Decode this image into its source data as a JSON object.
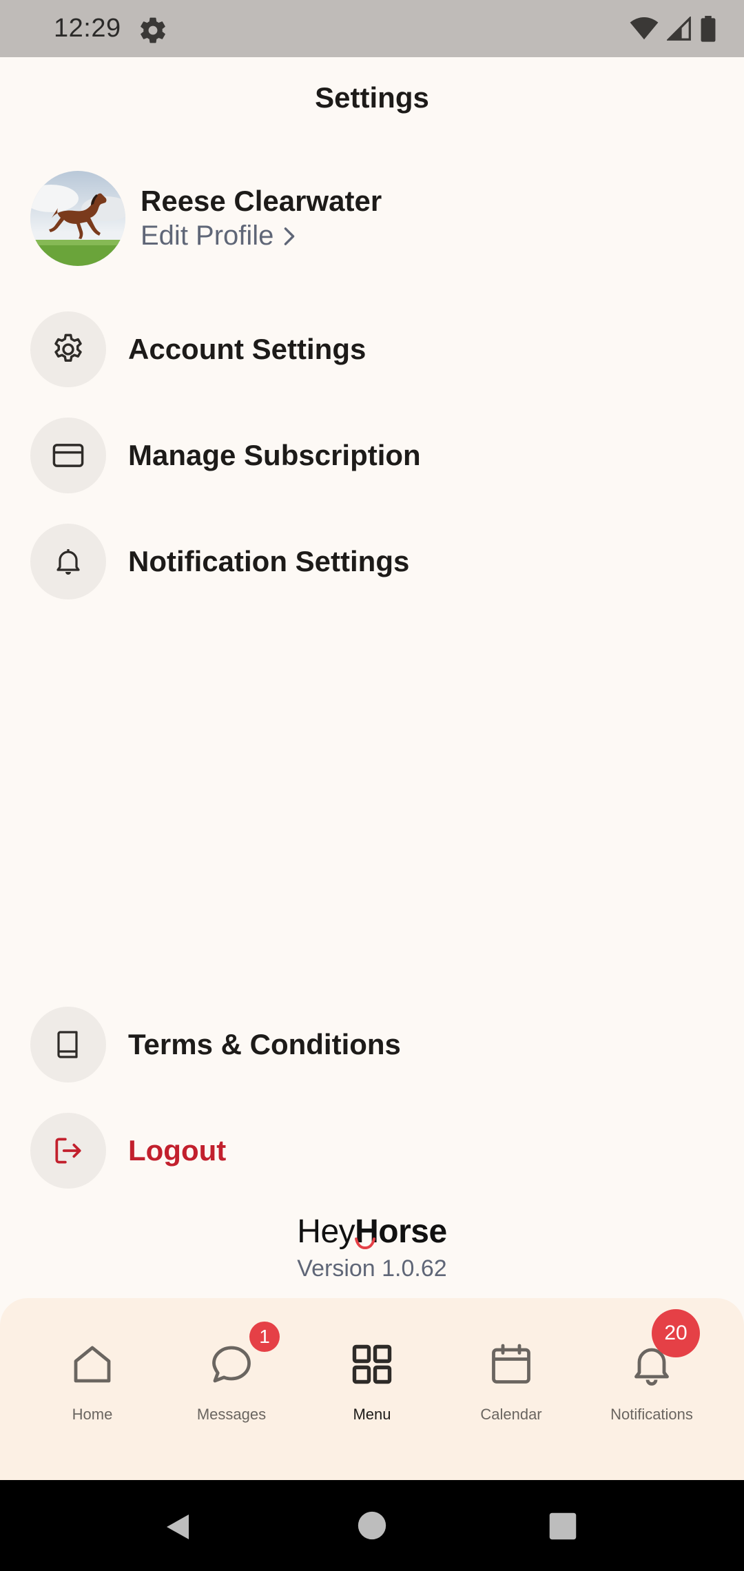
{
  "status_bar": {
    "time": "12:29"
  },
  "header": {
    "title": "Settings"
  },
  "profile": {
    "name": "Reese Clearwater",
    "edit_label": "Edit Profile"
  },
  "menu": {
    "items": [
      {
        "label": "Account Settings",
        "icon": "gear-icon"
      },
      {
        "label": "Manage Subscription",
        "icon": "credit-card-icon"
      },
      {
        "label": "Notification Settings",
        "icon": "bell-icon"
      }
    ],
    "terms_label": "Terms & Conditions",
    "logout_label": "Logout"
  },
  "brand": {
    "hey": "Hey",
    "horse": "Horse",
    "version": "Version 1.0.62"
  },
  "bottom_nav": {
    "items": [
      {
        "label": "Home",
        "icon": "home-icon",
        "active": false
      },
      {
        "label": "Messages",
        "icon": "chat-bubble-icon",
        "badge": "1",
        "active": false
      },
      {
        "label": "Menu",
        "icon": "grid-icon",
        "active": true
      },
      {
        "label": "Calendar",
        "icon": "calendar-icon",
        "active": false
      },
      {
        "label": "Notifications",
        "icon": "bell-icon",
        "badge": "20",
        "active": false
      }
    ]
  },
  "colors": {
    "background": "#fdf9f5",
    "danger": "#c2202d",
    "badge": "#e54046",
    "bottom_nav_bg": "#fcf0e4",
    "muted_text": "#5f6677"
  }
}
